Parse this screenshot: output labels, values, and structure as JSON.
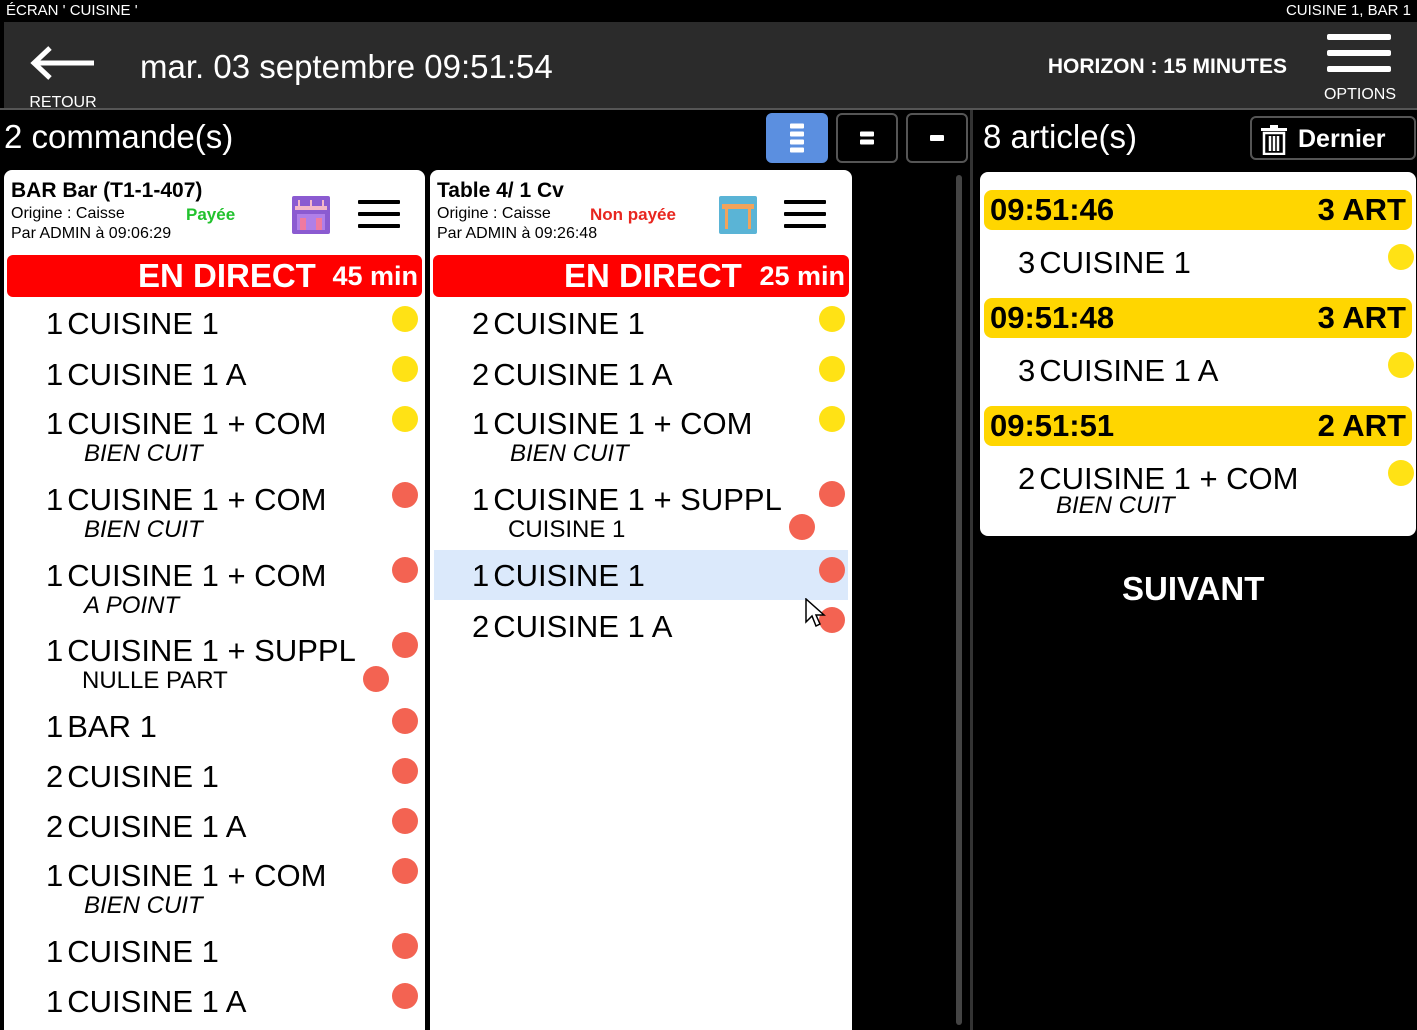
{
  "topbar": {
    "left": "ÉCRAN ' CUISINE '",
    "right": "CUISINE 1, BAR 1"
  },
  "header": {
    "back_label": "RETOUR",
    "datetime": "mar. 03 septembre 09:51:54",
    "horizon": "HORIZON : 15 MINUTES",
    "options_label": "OPTIONS"
  },
  "orders_title": "2 commande(s)",
  "articles_title": "8 article(s)",
  "dernier_label": "Dernier",
  "suivant_label": "SUIVANT",
  "colors": {
    "yellow": "#ffe215",
    "red": "#f36352",
    "live": "#ff0000",
    "active_view": "#5b8fe0",
    "paid": "#22c22e",
    "unpaid": "#e8261f",
    "group_header": "#ffd600"
  },
  "orders": [
    {
      "title": "BAR Bar (T1-1-407)",
      "origin": "Origine : Caisse",
      "by": "Par ADMIN à 09:06:29",
      "payment": "Payée",
      "icon": "bar-icon",
      "live_label": "EN DIRECT",
      "live_time": "45 min",
      "items": [
        {
          "qty": "1",
          "name": "CUISINE 1",
          "status": "yellow"
        },
        {
          "qty": "1",
          "name": "CUISINE 1 A",
          "status": "yellow"
        },
        {
          "qty": "1",
          "name": "CUISINE 1 + COM",
          "note": "BIEN CUIT",
          "status": "yellow"
        },
        {
          "qty": "1",
          "name": "CUISINE 1 + COM",
          "note": "BIEN CUIT",
          "status": "red"
        },
        {
          "qty": "1",
          "name": "CUISINE 1 + COM",
          "note": "A POINT",
          "status": "red"
        },
        {
          "qty": "1",
          "name": "CUISINE 1 + SUPPL",
          "suppl": "NULLE PART",
          "status": "red"
        },
        {
          "qty": "1",
          "name": "BAR 1",
          "status": "red"
        },
        {
          "qty": "2",
          "name": "CUISINE 1",
          "status": "red"
        },
        {
          "qty": "2",
          "name": "CUISINE 1 A",
          "status": "red"
        },
        {
          "qty": "1",
          "name": "CUISINE 1 + COM",
          "note": "BIEN CUIT",
          "status": "red"
        },
        {
          "qty": "1",
          "name": "CUISINE 1",
          "status": "red"
        },
        {
          "qty": "1",
          "name": "CUISINE 1 A",
          "status": "red"
        }
      ]
    },
    {
      "title": "Table 4/ 1 Cv",
      "origin": "Origine : Caisse",
      "by": "Par ADMIN à 09:26:48",
      "payment": "Non payée",
      "icon": "table-icon",
      "live_label": "EN DIRECT",
      "live_time": "25 min",
      "items": [
        {
          "qty": "2",
          "name": "CUISINE 1",
          "status": "yellow"
        },
        {
          "qty": "2",
          "name": "CUISINE 1 A",
          "status": "yellow"
        },
        {
          "qty": "1",
          "name": "CUISINE 1 + COM",
          "note": "BIEN CUIT",
          "status": "yellow"
        },
        {
          "qty": "1",
          "name": "CUISINE 1 + SUPPL",
          "suppl": "CUISINE 1",
          "status": "red"
        },
        {
          "qty": "1",
          "name": "CUISINE 1",
          "status": "red",
          "selected": true
        },
        {
          "qty": "2",
          "name": "CUISINE 1 A",
          "status": "red"
        }
      ]
    }
  ],
  "articles": [
    {
      "time": "09:51:46",
      "count": "3 ART",
      "qty": "3",
      "name": "CUISINE 1"
    },
    {
      "time": "09:51:48",
      "count": "3 ART",
      "qty": "3",
      "name": "CUISINE 1 A"
    },
    {
      "time": "09:51:51",
      "count": "2 ART",
      "qty": "2",
      "name": "CUISINE 1 + COM",
      "note": "BIEN CUIT"
    }
  ]
}
